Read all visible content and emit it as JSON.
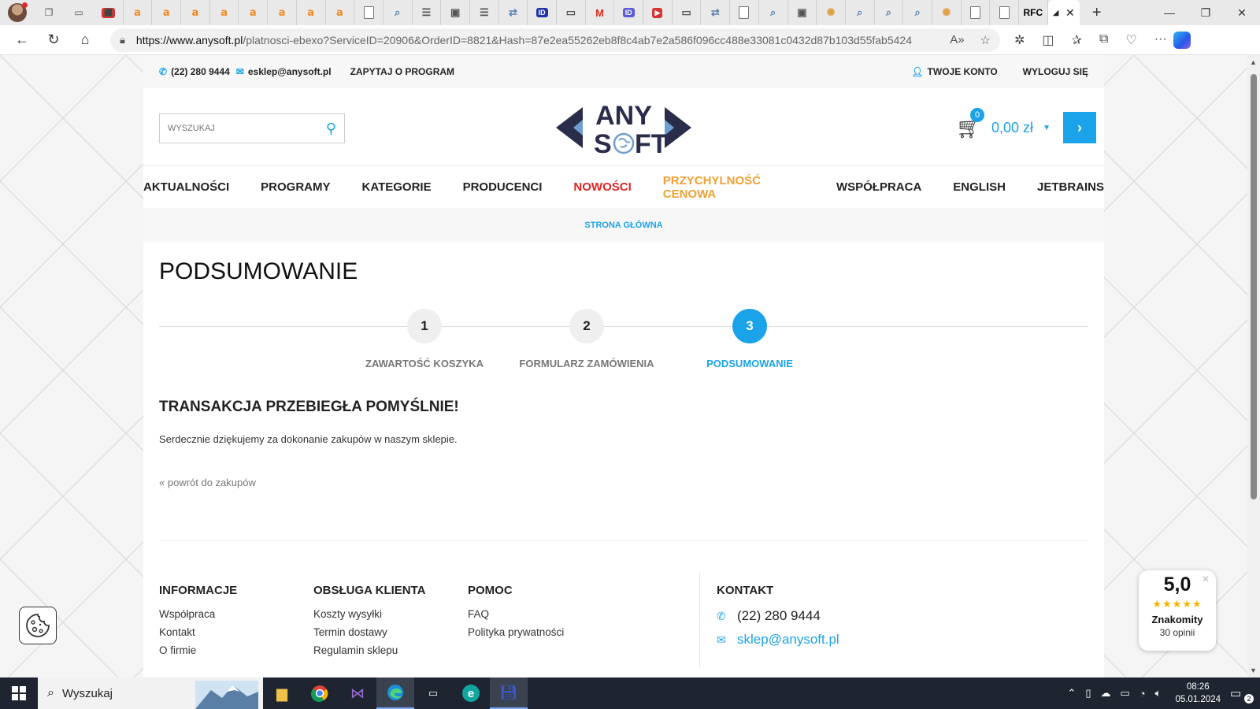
{
  "browser": {
    "address": {
      "host": "https://www.anysoft.pl",
      "path": "/platnosci-ebexo?ServiceID=20906&OrderID=8821&Hash=87e2ea55262eb8f8c4ab7e2a586f096cc488e33081c0432d87b103d55fab5424"
    },
    "mini_tab_rfc": "RFC"
  },
  "site": {
    "topbar": {
      "phone": "(22) 280 9444",
      "email": "esklep@anysoft.pl",
      "ask": "ZAPYTAJ O PROGRAM",
      "account": "TWOJE KONTO",
      "logout": "WYLOGUJ SIĘ"
    },
    "search": {
      "placeholder": "WYSZUKAJ"
    },
    "logo": {
      "top": "ANY",
      "bottom_left": "S",
      "bottom_right": "FT"
    },
    "cart": {
      "count": "0",
      "amount": "0,00 zł"
    },
    "nav": {
      "aktualnosci": "AKTUALNOŚCI",
      "programy": "PROGRAMY",
      "kategorie": "KATEGORIE",
      "producenci": "PRODUCENCI",
      "nowosci": "NOWOŚCI",
      "przychylnosc": "PRZYCHYLNOŚĆ CENOWA",
      "wspolpraca": "WSPÓŁPRACA",
      "english": "ENGLISH",
      "jetbrains": "JETBRAINS"
    },
    "breadcrumb": "STRONA GŁÓWNA",
    "page_title": "PODSUMOWANIE",
    "steps": [
      {
        "num": "1",
        "label": "ZAWARTOŚĆ KOSZYKA"
      },
      {
        "num": "2",
        "label": "FORMULARZ ZAMÓWIENIA"
      },
      {
        "num": "3",
        "label": "PODSUMOWANIE"
      }
    ],
    "success_heading": "TRANSAKCJA PRZEBIEGŁA POMYŚLNIE!",
    "success_text": "Serdecznie dziękujemy za dokonanie zakupów w naszym sklepie.",
    "back_link": "« powrót do zakupów",
    "footer": {
      "info": {
        "title": "INFORMACJE",
        "links": [
          "Współpraca",
          "Kontakt",
          "O firmie"
        ]
      },
      "service": {
        "title": "OBSŁUGA KLIENTA",
        "links": [
          "Koszty wysyłki",
          "Termin dostawy",
          "Regulamin sklepu"
        ]
      },
      "help": {
        "title": "POMOC",
        "links": [
          "FAQ",
          "Polityka prywatności"
        ]
      },
      "contact": {
        "title": "KONTAKT",
        "phone": "(22) 280 9444",
        "email": "sklep@anysoft.pl"
      }
    },
    "rating": {
      "score": "5,0",
      "word": "Znakomity",
      "count": "30 opinii"
    }
  },
  "taskbar": {
    "search_placeholder": "Wyszukaj",
    "time": "08:26",
    "date": "05.01.2024",
    "notifications": "2"
  },
  "colors": {
    "accent": "#1aa3e8",
    "nav_red": "#e02424",
    "nav_orange": "#f0a030",
    "logo_dark": "#2a2d4a"
  }
}
